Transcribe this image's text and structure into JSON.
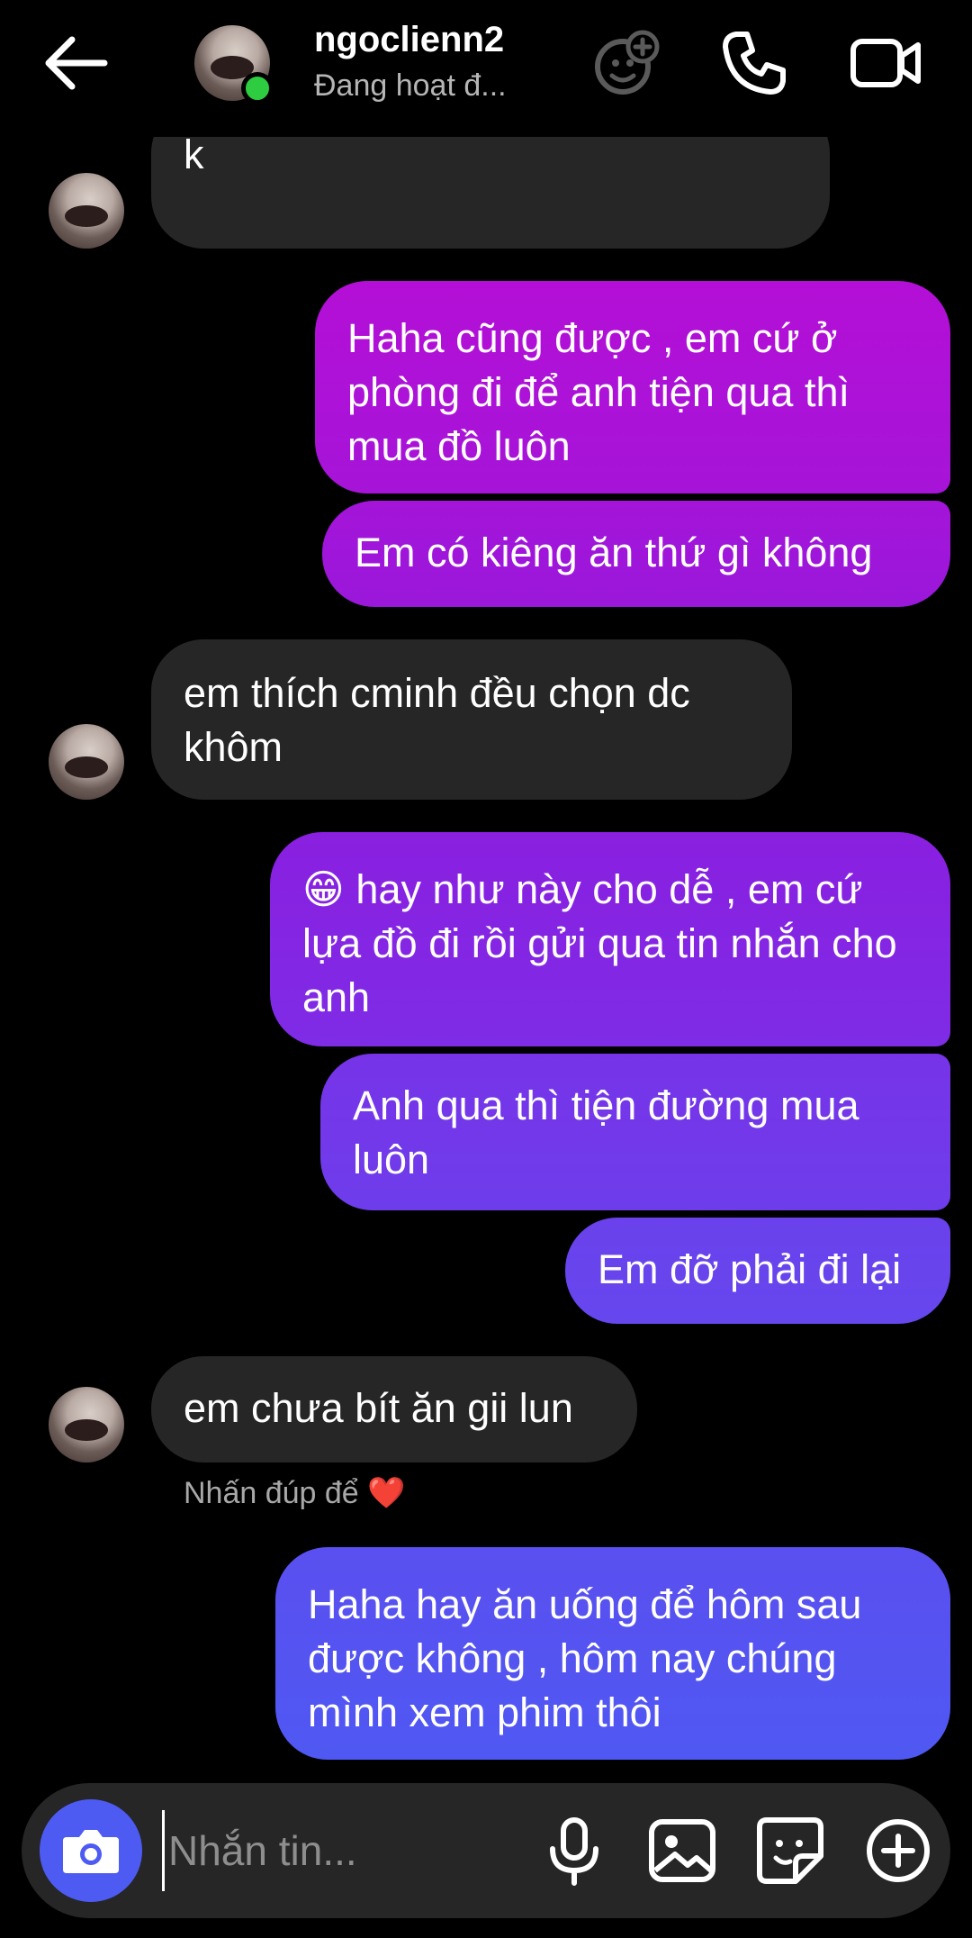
{
  "header": {
    "name": "ngoclienn2",
    "status": "Đang hoạt đ..."
  },
  "messages": [
    {
      "dir": "in",
      "text": "sang mua đồ về phòng e uống k"
    },
    {
      "dir": "out",
      "text": "Haha cũng được , em cứ ở phòng đi để anh tiện qua thì mua đồ luôn"
    },
    {
      "dir": "out",
      "text": "Em có kiêng ăn thứ gì không"
    },
    {
      "dir": "in",
      "text": "em thích cminh đều chọn dc khôm"
    },
    {
      "dir": "out",
      "text": "😁 hay như này cho dễ , em cứ lựa đồ đi rồi gửi qua tin nhắn cho anh"
    },
    {
      "dir": "out",
      "text": "Anh qua thì tiện đường mua luôn"
    },
    {
      "dir": "out",
      "text": "Em đỡ phải đi lại"
    },
    {
      "dir": "in",
      "text": "em chưa bít ăn gii lun"
    },
    {
      "dir": "out",
      "text": "Haha hay ăn uống để hôm sau được không , hôm nay chúng mình xem phim thôi"
    }
  ],
  "hint": "Nhấn đúp để ❤️",
  "composer": {
    "placeholder": "Nhắn tin..."
  },
  "colors": {
    "incoming_bubble": "#262626",
    "out_top": "#b40fd6",
    "out_bottom": "#4f58f2",
    "accent": "#4d5bf3",
    "online": "#2ecc40"
  },
  "icons": [
    "back-arrow-icon",
    "add-effect-icon",
    "phone-icon",
    "video-icon",
    "camera-icon",
    "microphone-icon",
    "image-icon",
    "sticker-icon",
    "plus-icon"
  ]
}
